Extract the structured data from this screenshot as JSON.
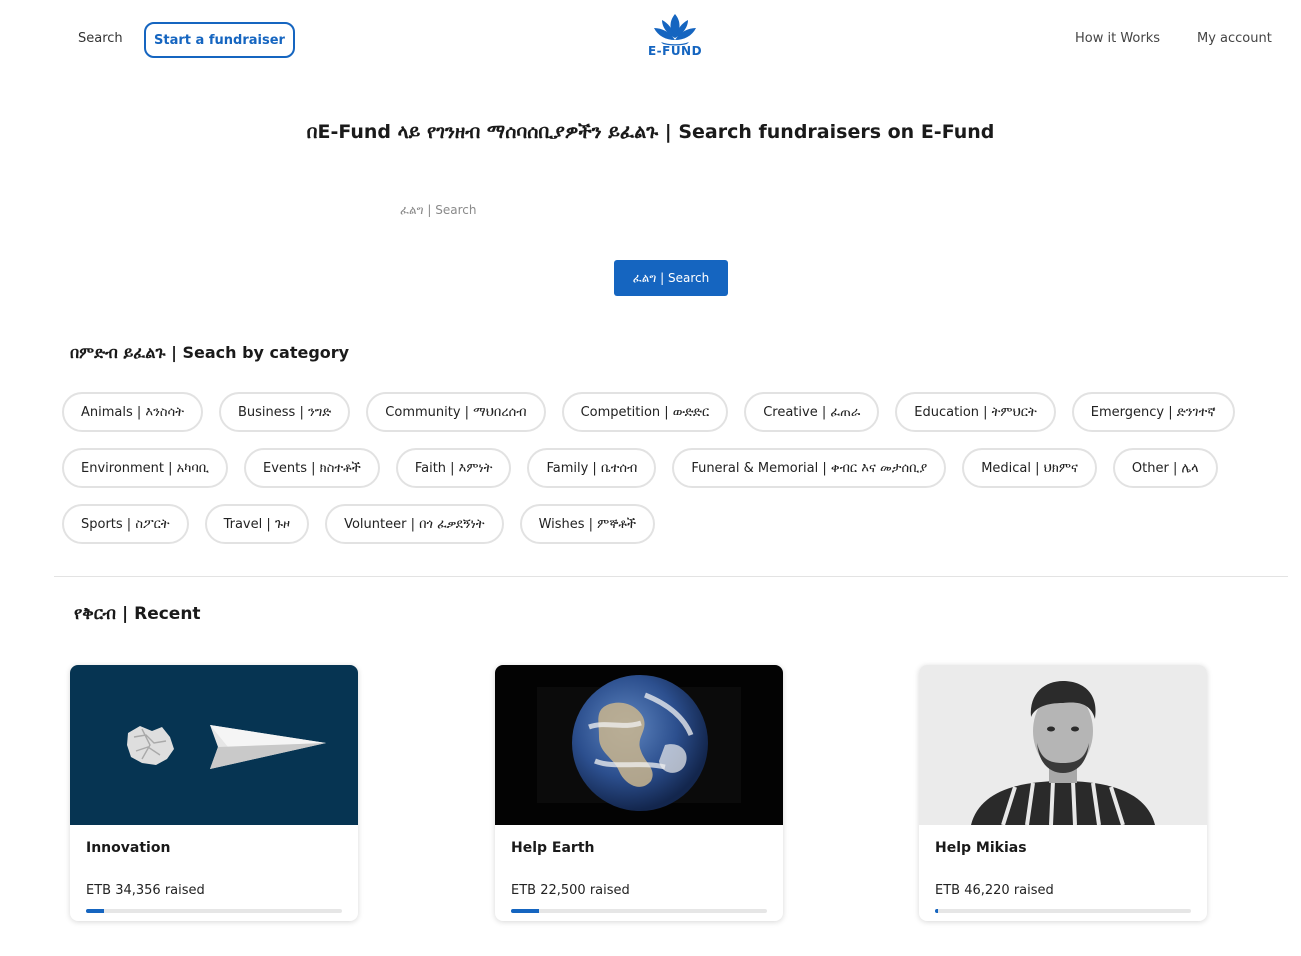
{
  "nav": {
    "search": "Search",
    "start": "Start a fundraiser",
    "logo": "E-FUND",
    "how": "How it Works",
    "account": "My account"
  },
  "hero": {
    "title": "በE-Fund ላይ የገንዘብ ማሰባሰቢያዎችን ይፈልጉ | Search fundraisers on E-Fund",
    "placeholder": "ፈልግ | Search",
    "button": "ፈልግ | Search"
  },
  "categories": {
    "heading": "በምድብ ይፈልጉ | Seach by category",
    "items": [
      "Animals | እንስሳት",
      "Business | ንግድ",
      "Community | ማህበረሰብ",
      "Competition | ውድድር",
      "Creative | ፈጠራ",
      "Education | ትምህርት",
      "Emergency | ድንገተኛ",
      "Environment | አካባቢ",
      "Events | ክስተቶች",
      "Faith | እምነት",
      "Family | ቤተሰብ",
      "Funeral & Memorial | ቀብር እና መታሰቢያ",
      "Medical | ህክምና",
      "Other | ሌላ",
      "Sports | ስፖርት",
      "Travel | ጉዞ",
      "Volunteer | በጎ ፈቃደኝነት",
      "Wishes | ምኞቶች"
    ]
  },
  "recent": {
    "heading": "የቅርብ | Recent",
    "cards": [
      {
        "title": "Innovation",
        "raised": "ETB 34,356 raised",
        "progress": 0.07,
        "image": "paper-plane-image"
      },
      {
        "title": "Help Earth",
        "raised": "ETB 22,500 raised",
        "progress": 0.11,
        "image": "earth-image"
      },
      {
        "title": "Help Mikias",
        "raised": "ETB 46,220 raised",
        "progress": 0.01,
        "image": "portrait-image"
      }
    ]
  },
  "colors": {
    "brand": "#1565c0",
    "chipBorder": "#e2e2e2"
  }
}
